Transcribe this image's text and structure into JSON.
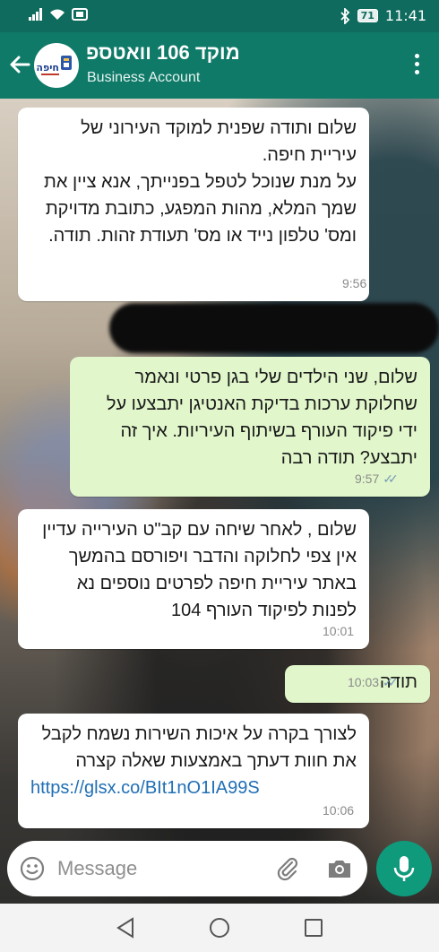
{
  "status_bar": {
    "time": "11:41",
    "battery": "71"
  },
  "header": {
    "title": "מוקד 106 וואטספ",
    "subtitle": "Business Account",
    "avatar_text": "חיפה"
  },
  "messages": [
    {
      "direction": "incoming",
      "text": "שלום ותודה שפנית למוקד העירוני של עיריית חיפה.\nעל מנת שנוכל לטפל בפנייתך, אנא ציין את שמך המלא, מהות המפגע, כתובת מדויקת ומס' טלפון נייד או מס' תעודת זהות. תודה.",
      "time": "9:56"
    },
    {
      "direction": "outgoing",
      "text": "שלום, שני הילדים שלי בגן פרטי ונאמר שחלוקת ערכות בדיקת האנטיגן יתבצעו על ידי פיקוד העורף בשיתוף העיריות. איך זה יתבצע? תודה רבה",
      "time": "9:57"
    },
    {
      "direction": "incoming",
      "text": "שלום , לאחר שיחה עם קב\"ט העירייה עדיין אין צפי לחלוקה והדבר ויפורסם בהמשך באתר עיריית חיפה לפרטים נוספים נא לפנות לפיקוד העורף 104",
      "time": "10:01"
    },
    {
      "direction": "outgoing",
      "text": "תודה",
      "time": "10:03"
    },
    {
      "direction": "incoming",
      "text": "לצורך בקרה על איכות השירות נשמח לקבל את חוות דעתך באמצעות שאלה קצרה",
      "link": "https://glsx.co/BIt1nO1IA99S",
      "time": "10:06"
    }
  ],
  "input": {
    "placeholder": "Message"
  },
  "colors": {
    "header": "#0f7a68",
    "outgoing_bubble": "#e1f7cb",
    "incoming_bubble": "#ffffff",
    "mic_button": "#0f9a7c"
  }
}
